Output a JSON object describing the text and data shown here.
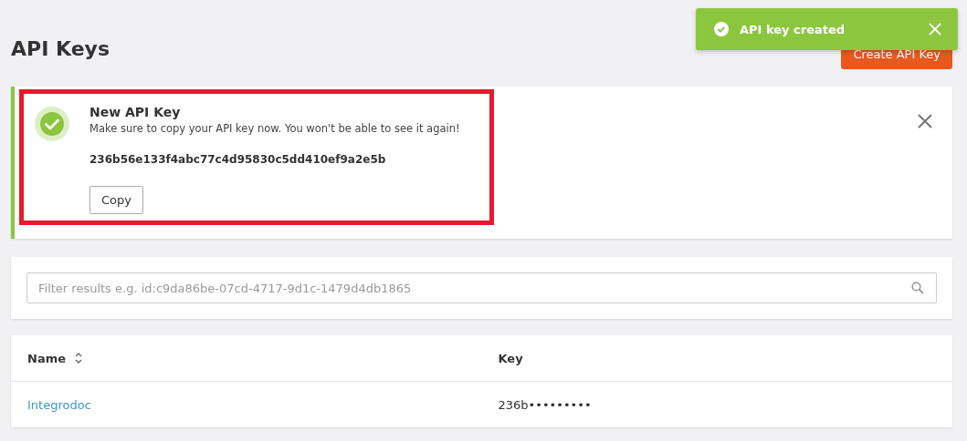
{
  "page": {
    "title": "API Keys",
    "create_button": "Create API Key"
  },
  "toast": {
    "kind": "success",
    "message": "API key created"
  },
  "new_key_notice": {
    "kind": "success",
    "highlighted": true,
    "title": "New API Key",
    "message": "Make sure to copy your API key now. You won't be able to see it again!",
    "key": "236b56e133f4abc77c4d95830c5dd410ef9a2e5b",
    "copy_button": "Copy"
  },
  "filter": {
    "placeholder": "Filter results e.g. id:c9da86be-07cd-4717-9d1c-1479d4db1865"
  },
  "table": {
    "columns": [
      {
        "label": "Name",
        "sortable": true
      },
      {
        "label": "Key",
        "sortable": false
      }
    ],
    "rows": [
      {
        "name": "Integrodoc",
        "key": "236b•••••••••"
      }
    ]
  }
}
